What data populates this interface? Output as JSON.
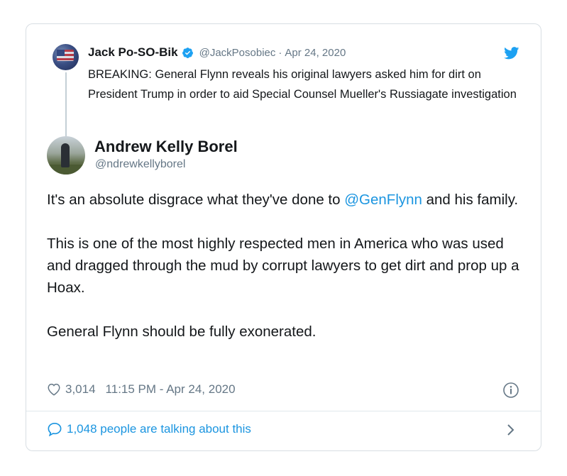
{
  "parent_tweet": {
    "name": "Jack Po-SO-Bik",
    "handle": "@JackPosobiec",
    "separator": "·",
    "date": "Apr 24, 2020",
    "text": "BREAKING: General Flynn reveals his original lawyers asked him for dirt on President Trump in order to aid Special Counsel Mueller's Russiagate investigation",
    "verified_icon": "verified-badge-icon",
    "avatar_icon": "profile-avatar"
  },
  "tweet": {
    "name": "Andrew Kelly Borel",
    "handle": "@ndrewkellyborel",
    "para1_before": "It's an absolute disgrace what they've done to ",
    "para1_mention": "@GenFlynn",
    "para1_after": " and his family.",
    "para2": "This is one of the most highly respected men in America who was used and dragged through the mud by corrupt lawyers to get dirt and prop up a Hoax.",
    "para3": "General Flynn should be fully exonerated.",
    "likes": "3,014",
    "timestamp": "11:15 PM - Apr 24, 2020"
  },
  "footer": {
    "label": "1,048 people are talking about this"
  },
  "icons": {
    "brand": "twitter-bird-icon",
    "like": "heart-icon",
    "info": "info-icon",
    "reply": "speech-bubble-icon",
    "chevron": "chevron-right-icon"
  },
  "colors": {
    "link": "#1b95e0",
    "muted": "#657786",
    "text": "#14171a",
    "border": "#d8dee3"
  }
}
